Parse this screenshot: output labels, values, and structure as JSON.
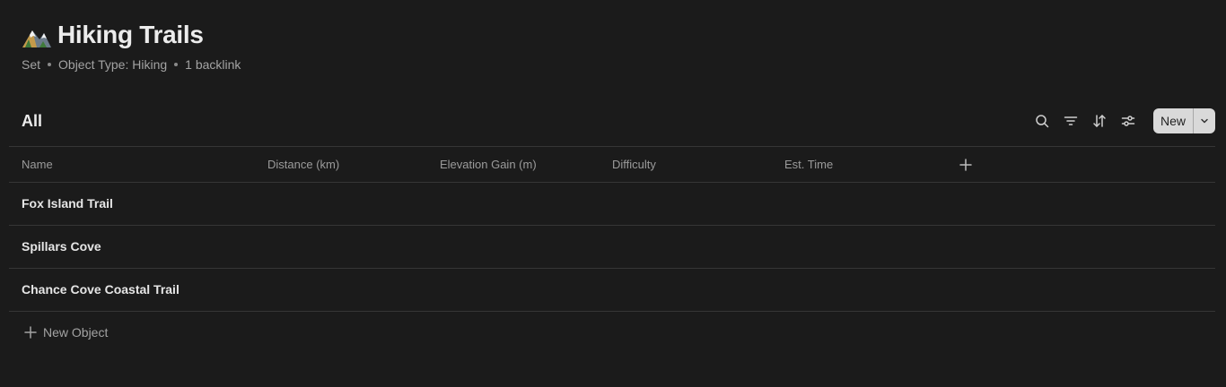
{
  "header": {
    "icon": "mountain-icon",
    "title": "Hiking Trails",
    "meta": [
      "Set",
      "Object Type: Hiking",
      "1 backlink"
    ]
  },
  "view": {
    "title": "All",
    "tools": [
      "search-icon",
      "filter-icon",
      "sort-icon",
      "settings-icon"
    ],
    "new_label": "New"
  },
  "table": {
    "columns": [
      "Name",
      "Distance (km)",
      "Elevation Gain (m)",
      "Difficulty",
      "Est. Time"
    ],
    "rows": [
      {
        "name": "Fox Island Trail"
      },
      {
        "name": "Spillars Cove"
      },
      {
        "name": "Chance Cove Coastal Trail"
      }
    ],
    "new_object_label": "New Object"
  },
  "colors": {
    "background": "#1b1b1b",
    "text": "#e8e8e8",
    "muted": "#a3a3a3",
    "border": "#363636",
    "button_bg": "#d9d9d9"
  }
}
